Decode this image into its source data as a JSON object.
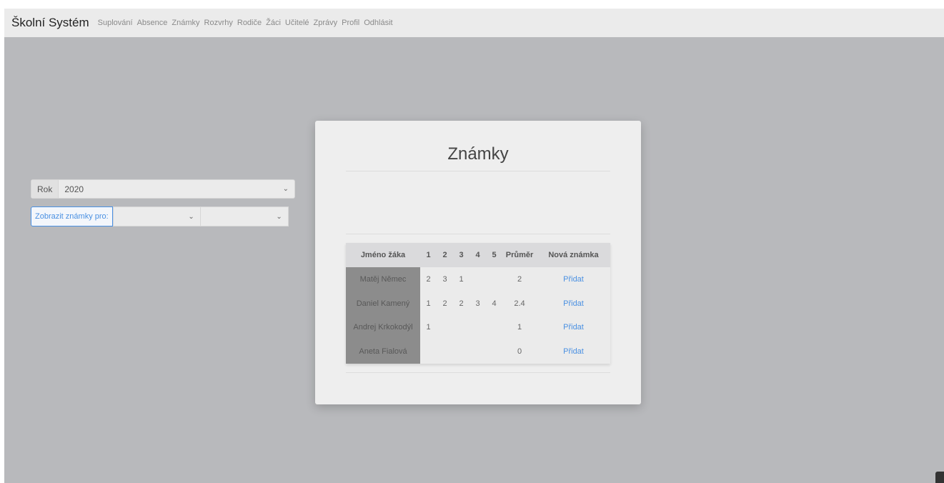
{
  "navbar": {
    "brand": "Školní Systém",
    "links": [
      "Suplování",
      "Absence",
      "Známky",
      "Rozvrhy",
      "Rodiče",
      "Žáci",
      "Učitelé",
      "Zprávy",
      "Profil",
      "Odhlásit"
    ]
  },
  "modal": {
    "title": "Známky",
    "year_label": "Rok",
    "year_value": "2020",
    "filter_button": "Zobrazit známky pro:",
    "filter_select_1": "",
    "filter_select_2": ""
  },
  "table": {
    "headers": [
      "Jméno žáka",
      "1",
      "2",
      "3",
      "4",
      "5",
      "Průměr",
      "Nová známka"
    ],
    "rows": [
      {
        "name": "Matěj Němec",
        "g": [
          "2",
          "3",
          "1",
          "",
          ""
        ],
        "avg": "2",
        "action": "Přidat"
      },
      {
        "name": "Daniel Kamený",
        "g": [
          "1",
          "2",
          "2",
          "3",
          "4"
        ],
        "avg": "2.4",
        "action": "Přidat"
      },
      {
        "name": "Andrej Krkokodýl",
        "g": [
          "1",
          "",
          "",
          "",
          ""
        ],
        "avg": "1",
        "action": "Přidat"
      },
      {
        "name": "Aneta Fialová",
        "g": [
          "",
          "",
          "",
          "",
          ""
        ],
        "avg": "0",
        "action": "Přidat"
      }
    ]
  },
  "icons": {
    "select_chevron": "chevron-down-icon"
  }
}
